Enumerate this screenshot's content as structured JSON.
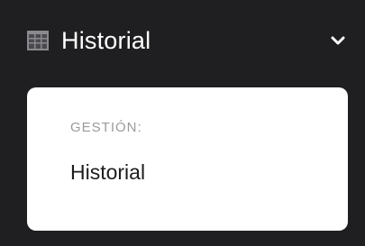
{
  "sidebar": {
    "item": {
      "icon": "table-icon",
      "label": "Historial",
      "expand_icon": "chevron-down-icon"
    }
  },
  "submenu": {
    "section_header": "GESTIÓN:",
    "items": [
      {
        "label": "Historial"
      }
    ]
  },
  "colors": {
    "background": "#1f1f21",
    "card": "#ffffff",
    "header_text": "#9a9a9a",
    "item_text": "#1d1d1f"
  }
}
